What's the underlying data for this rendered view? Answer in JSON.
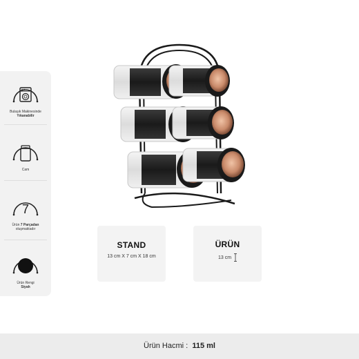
{
  "features": [
    {
      "icon": "dishwasher-icon",
      "line1": "Bulaşık Makinesinde",
      "line2": "Yıkanabilir"
    },
    {
      "icon": "glass-jar-icon",
      "line1": "Cam",
      "line2": ""
    },
    {
      "icon": "seven-icon",
      "number": "7",
      "line1_a": "Ürün ",
      "line1_b": "7 Parçadan",
      "line2": "oluşmaktadır"
    },
    {
      "icon": "black-color-swatch-icon",
      "line1": "Ürün Rengi",
      "line2": "Siyah"
    }
  ],
  "cards": {
    "stand": {
      "title": "STAND",
      "value": "13 cm X 7 cm X 18 cm"
    },
    "product": {
      "title": "ÜRÜN",
      "value": "13 cm"
    }
  },
  "volume": {
    "label": "Ürün Hacmi :",
    "value": "115 ml"
  },
  "colors": {
    "panel": "#f2f2f2",
    "card": "#f3f3f3",
    "copper": "#c98a6a",
    "black": "#1a1a1a"
  }
}
